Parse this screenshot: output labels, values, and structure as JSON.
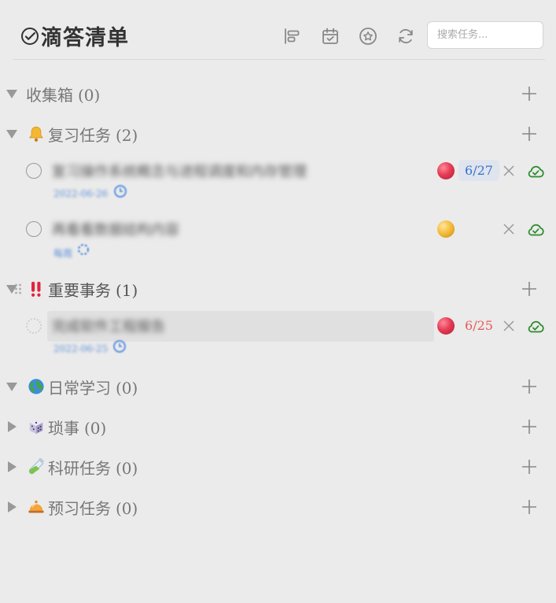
{
  "header": {
    "title": "滴答清单",
    "search_placeholder": "搜索任务...",
    "toolbar_icons": [
      "align-left-icon",
      "calendar-check-icon",
      "star-circle-icon",
      "refresh-icon"
    ]
  },
  "groups": [
    {
      "name": "收集箱",
      "count": "(0)",
      "emoji": "",
      "expanded": true
    },
    {
      "name": "复习任务",
      "count": "(2)",
      "emoji": "bell-icon",
      "expanded": true
    },
    {
      "name": "重要事务",
      "count": "(1)",
      "emoji": "double-exclamation-icon",
      "expanded": true
    },
    {
      "name": "日常学习",
      "count": "(0)",
      "emoji": "globe-icon",
      "expanded": true
    },
    {
      "name": "琐事",
      "count": "(0)",
      "emoji": "dice-icon",
      "expanded": false
    },
    {
      "name": "科研任务",
      "count": "(0)",
      "emoji": "test-tube-icon",
      "expanded": false
    },
    {
      "name": "预习任务",
      "count": "(0)",
      "emoji": "service-bell-icon",
      "expanded": false
    }
  ],
  "tasks": [
    {
      "group": "复习任务",
      "title": "复习操作系统概念与进程调度和内存管理",
      "priority": "high",
      "priority_color": "#e63c55",
      "due": "6/27",
      "due_style": "blue",
      "meta": "2022-06-26"
    },
    {
      "group": "复习任务",
      "title": "再看看数据结构内容",
      "priority": "medium",
      "priority_color": "#f2b936",
      "due": "",
      "due_style": "",
      "meta": "每周"
    },
    {
      "group": "重要事务",
      "title": "完成软件工程报告",
      "priority": "high",
      "priority_color": "#e63c55",
      "due": "6/25",
      "due_style": "red",
      "meta": "2022-06-25"
    }
  ],
  "colors": {
    "background": "#ebebeb",
    "accent_blue": "#3a73c8",
    "due_red": "#e85a5a",
    "sync_green": "#2e8b2e"
  }
}
